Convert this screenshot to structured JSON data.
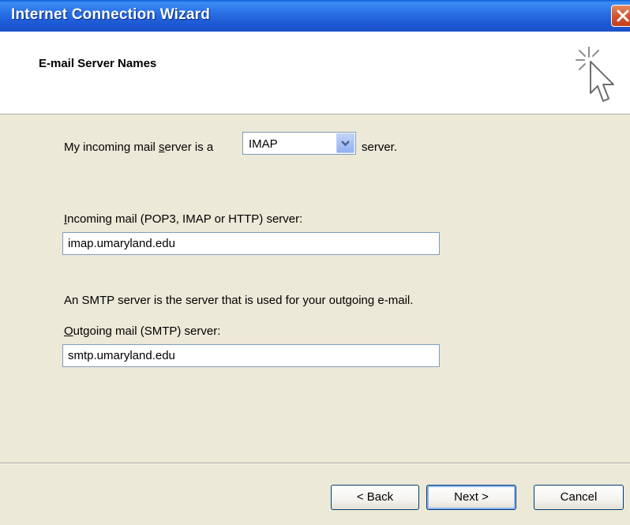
{
  "window": {
    "title": "Internet Connection Wizard"
  },
  "header": {
    "title": "E-mail Server Names"
  },
  "incoming_type": {
    "label_prefix": "My incoming mail server is a ",
    "label_suffix": "server.",
    "selected": "IMAP"
  },
  "incoming_server": {
    "label": "Incoming mail (POP3, IMAP or HTTP) server:",
    "value": "imap.umaryland.edu"
  },
  "smtp_note": "An SMTP server is the server that is used for your outgoing e-mail.",
  "outgoing_server": {
    "label": "Outgoing mail (SMTP) server:",
    "value": "smtp.umaryland.edu"
  },
  "buttons": {
    "back": "Back",
    "next": "Next",
    "cancel": "Cancel"
  },
  "colors": {
    "titlebar": "#2B71E6",
    "dialog_bg": "#ECE9D8",
    "close": "#D4512B"
  }
}
